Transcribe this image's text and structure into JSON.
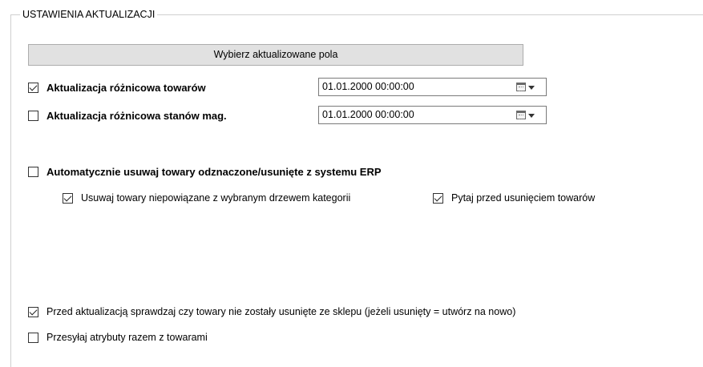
{
  "group": {
    "title": "USTAWIENIA AKTUALIZACJI"
  },
  "select_fields_button": {
    "label": "Wybierz aktualizowane pola"
  },
  "diff_products": {
    "checked": true,
    "label": "Aktualizacja różnicowa towarów",
    "date": "01.01.2000 00:00:00"
  },
  "diff_stock": {
    "checked": false,
    "label": "Aktualizacja różnicowa stanów mag.",
    "date": "01.01.2000 00:00:00"
  },
  "auto_remove": {
    "checked": false,
    "label": "Automatycznie usuwaj towary odznaczone/usunięte z systemu ERP"
  },
  "remove_unlinked": {
    "checked": true,
    "label": "Usuwaj towary niepowiązane z wybranym drzewem kategorii"
  },
  "ask_before_remove": {
    "checked": true,
    "label": "Pytaj przed usunięciem towarów"
  },
  "check_deleted": {
    "checked": true,
    "label": "Przed aktualizacją sprawdzaj czy towary nie zostały usunięte ze sklepu (jeżeli usunięty = utwórz na nowo)"
  },
  "send_attributes": {
    "checked": false,
    "label": "Przesyłaj atrybuty razem z towarami"
  },
  "icons": {
    "calendar": "calendar-icon",
    "dropdown": "chevron-down-icon"
  }
}
